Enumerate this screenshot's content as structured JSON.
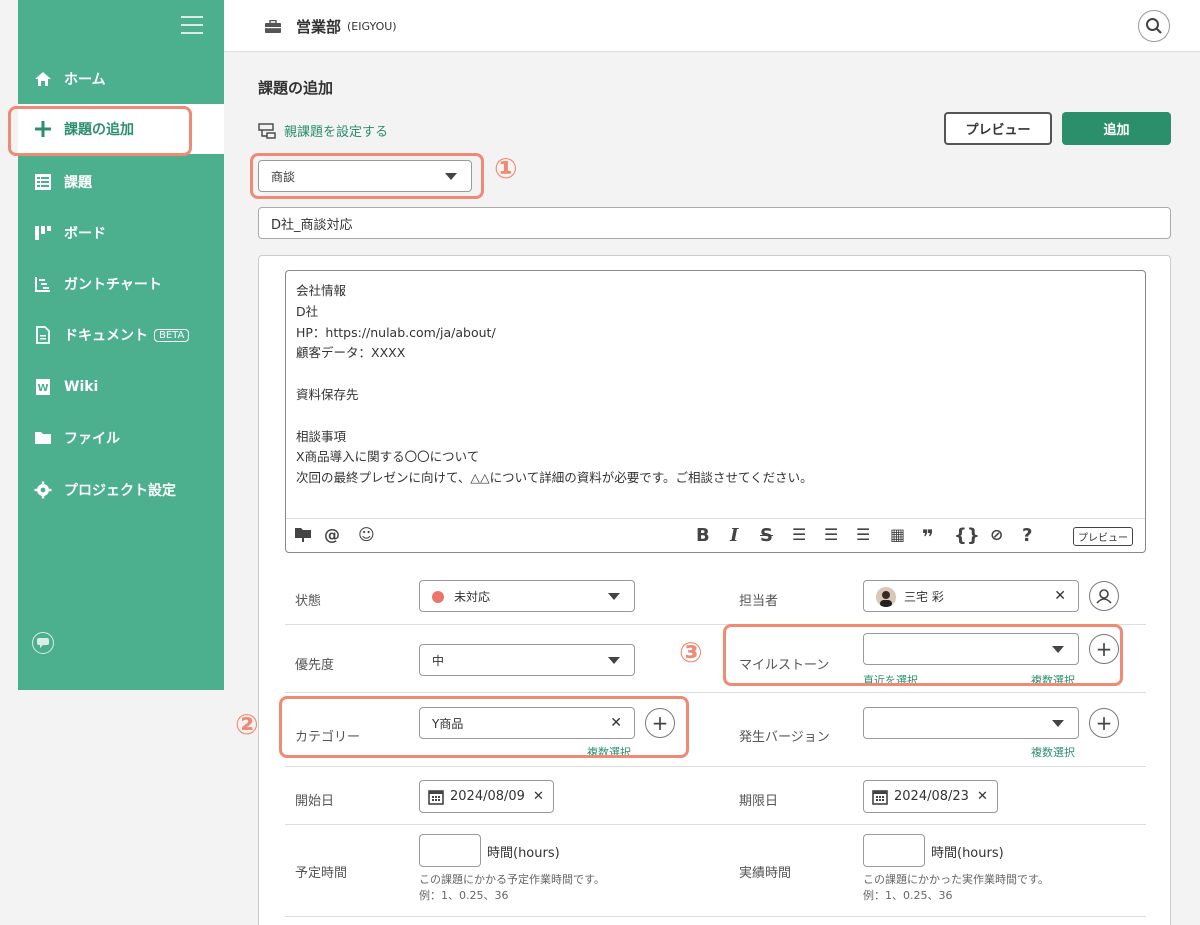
{
  "sidebar": {
    "items": [
      {
        "label": "ホーム"
      },
      {
        "label": "課題の追加"
      },
      {
        "label": "課題"
      },
      {
        "label": "ボード"
      },
      {
        "label": "ガントチャート"
      },
      {
        "label": "ドキュメント",
        "badge": "BETA"
      },
      {
        "label": "Wiki"
      },
      {
        "label": "ファイル"
      },
      {
        "label": "プロジェクト設定"
      }
    ]
  },
  "header": {
    "project_name": "営業部",
    "project_key": "(EIGYOU)"
  },
  "main": {
    "title": "課題の追加",
    "parent_link": "親課題を設定する",
    "preview_button": "プレビュー",
    "add_button": "追加",
    "issue_type": "商談",
    "summary": "D社_商談対応",
    "description": "会社情報\nD社\nHP：https://nulab.com/ja/about/\n顧客データ：XXXX\n\n資料保存先\n\n相談事項\nX商品導入に関する〇〇について\n次回の最終プレゼンに向けて、△△について詳細の資料が必要です。ご相談させてください。",
    "toolbar_preview": "プレビュー",
    "markers": {
      "m1": "①",
      "m2": "②",
      "m3": "③"
    },
    "fields": {
      "status": {
        "label": "状態",
        "value": "未対応",
        "color": "#e8776a"
      },
      "assignee": {
        "label": "担当者",
        "value": "三宅 彩"
      },
      "priority": {
        "label": "優先度",
        "value": "中"
      },
      "milestone": {
        "label": "マイルストーン",
        "value": "",
        "link_recent": "直近を選択",
        "link_multi": "複数選択"
      },
      "category": {
        "label": "カテゴリー",
        "value": "Y商品",
        "link_multi": "複数選択"
      },
      "version": {
        "label": "発生バージョン",
        "value": "",
        "link_multi": "複数選択"
      },
      "start_date": {
        "label": "開始日",
        "value": "2024/08/09"
      },
      "due_date": {
        "label": "期限日",
        "value": "2024/08/23"
      },
      "estimated_hours": {
        "label": "予定時間",
        "unit": "時間(hours)",
        "hint1": "この課題にかかる予定作業時間です。",
        "hint2": "例：1、0.25、36"
      },
      "actual_hours": {
        "label": "実績時間",
        "unit": "時間(hours)",
        "hint1": "この課題にかかった実作業時間です。",
        "hint2": "例：1、0.25、36"
      }
    }
  }
}
